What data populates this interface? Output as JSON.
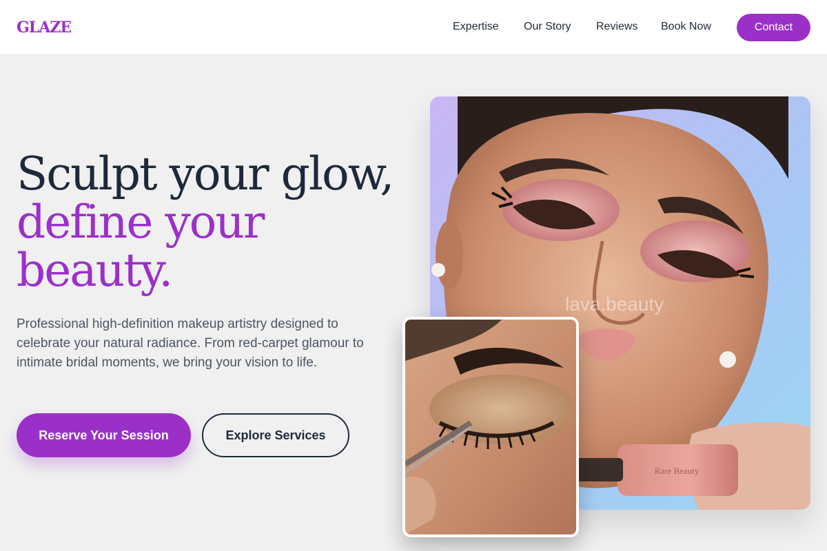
{
  "brand": {
    "logo": "GLAZE",
    "accent_color": "#9b30c9",
    "text_color": "#1e293b"
  },
  "nav": {
    "items": [
      {
        "label": "Expertise"
      },
      {
        "label": "Our Story"
      },
      {
        "label": "Reviews"
      },
      {
        "label": "Book Now"
      }
    ],
    "contact_label": "Contact"
  },
  "hero": {
    "title_line1": "Sculpt your glow,",
    "title_accent_line2": "define your",
    "title_accent_line3": "beauty.",
    "description": "Professional high-definition makeup artistry designed to celebrate your natural radiance. From red-carpet glamour to intimate bridal moments, we bring your vision to life.",
    "primary_cta": "Reserve Your Session",
    "secondary_cta": "Explore Services"
  },
  "images": {
    "main_watermark": "lava.beauty",
    "product_label": "Rare Beauty",
    "main_icon": "makeup-portrait-photo",
    "inset_icon": "eyelash-application-photo"
  }
}
